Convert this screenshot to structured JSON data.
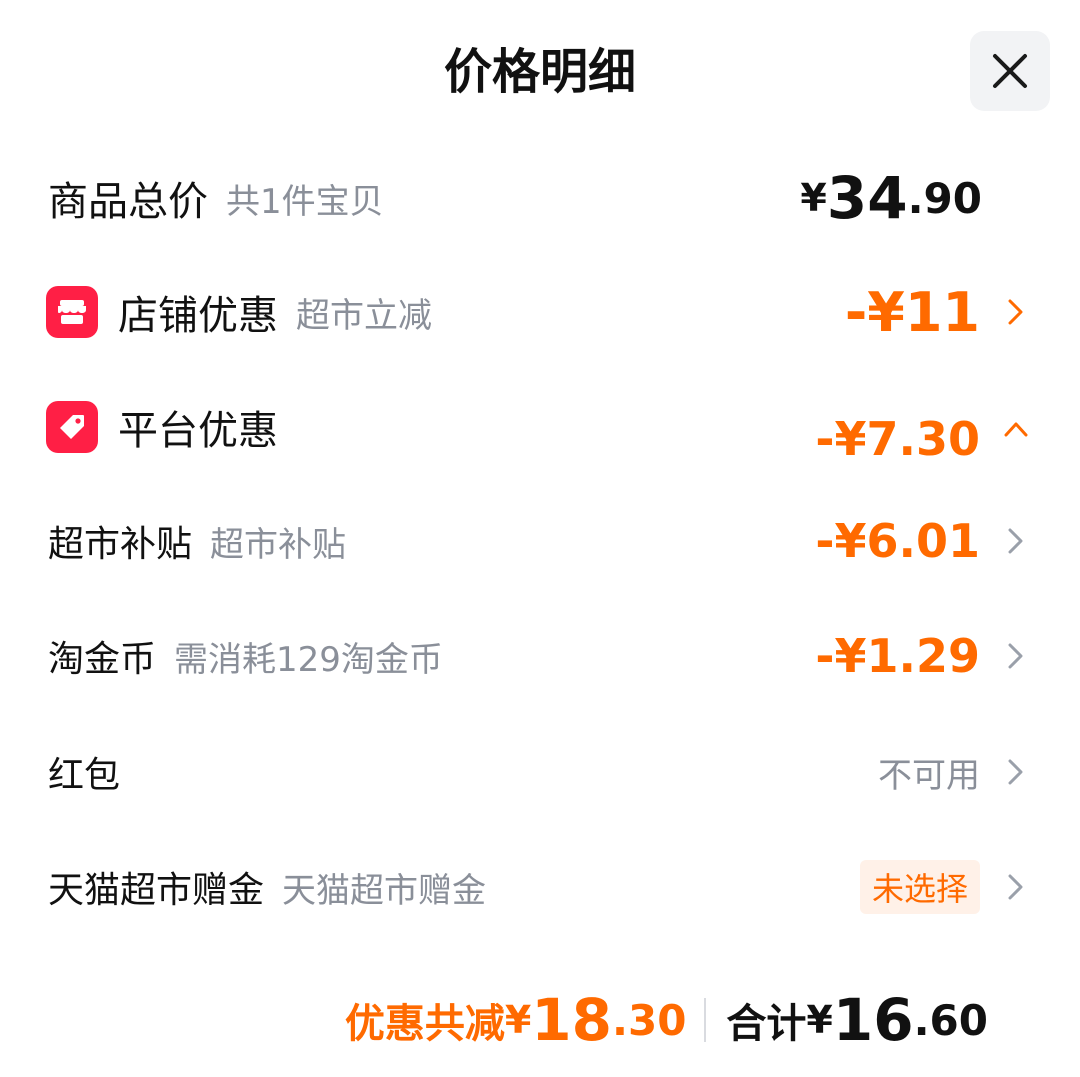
{
  "header": {
    "title": "价格明细",
    "close_icon": "close-icon"
  },
  "goods_total": {
    "label": "商品总价",
    "hint": "共1件宝贝",
    "currency": "¥",
    "integer": "34",
    "decimal": ".90"
  },
  "store_discount": {
    "icon": "shop-icon",
    "label": "店铺优惠",
    "hint": "超市立减",
    "amount": "-¥11",
    "chevron": "chevron-right-icon"
  },
  "platform_discount": {
    "icon": "tag-icon",
    "label": "平台优惠",
    "amount": "-¥7.30",
    "chevron": "chevron-up-icon"
  },
  "sub_items": [
    {
      "label": "超市补贴",
      "hint": "超市补贴",
      "amount": "-¥6.01"
    },
    {
      "label": "淘金币",
      "hint": "需消耗129淘金币",
      "amount": "-¥1.29"
    },
    {
      "label": "红包",
      "hint": "",
      "status": "不可用"
    },
    {
      "label": "天猫超市赠金",
      "hint": "天猫超市赠金",
      "status": "未选择"
    }
  ],
  "footer": {
    "discount_label": "优惠共减",
    "discount_currency": "¥",
    "discount_integer": "18",
    "discount_decimal": ".30",
    "total_label": "合计",
    "total_currency": "¥",
    "total_integer": "16",
    "total_decimal": ".60"
  },
  "colors": {
    "accent_orange": "#ff6a00",
    "icon_red": "#ff1f45",
    "hint_gray": "#8a8f99"
  }
}
